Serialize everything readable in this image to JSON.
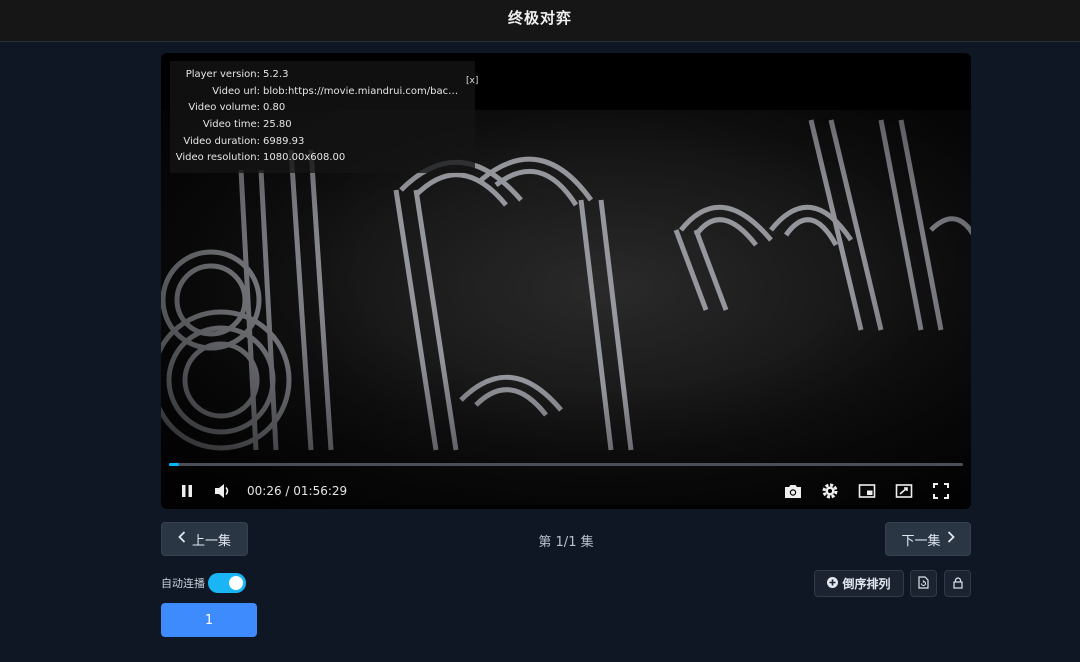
{
  "header": {
    "title": "终极对弈"
  },
  "player": {
    "info": [
      {
        "key": "Player version:",
        "value": "5.2.3"
      },
      {
        "key": "Video url:",
        "value": "blob:https://movie.miandrui.com/bac58c..."
      },
      {
        "key": "Video volume:",
        "value": "0.80"
      },
      {
        "key": "Video time:",
        "value": "25.80"
      },
      {
        "key": "Video duration:",
        "value": "6989.93"
      },
      {
        "key": "Video resolution:",
        "value": "1080.00x608.00"
      }
    ],
    "info_close": "[x]",
    "time_display": "00:26 / 01:56:29",
    "progress_fraction": 0.0037,
    "accent_color": "#00b6ff"
  },
  "episodes": {
    "prev_label": "上一集",
    "next_label": "下一集",
    "count_label": "第 1/1 集",
    "autoplay_label": "自动连播",
    "autoplay_on": true,
    "sort_label": "倒序排列",
    "items": [
      "1"
    ],
    "active_color": "#3d8bfd"
  }
}
